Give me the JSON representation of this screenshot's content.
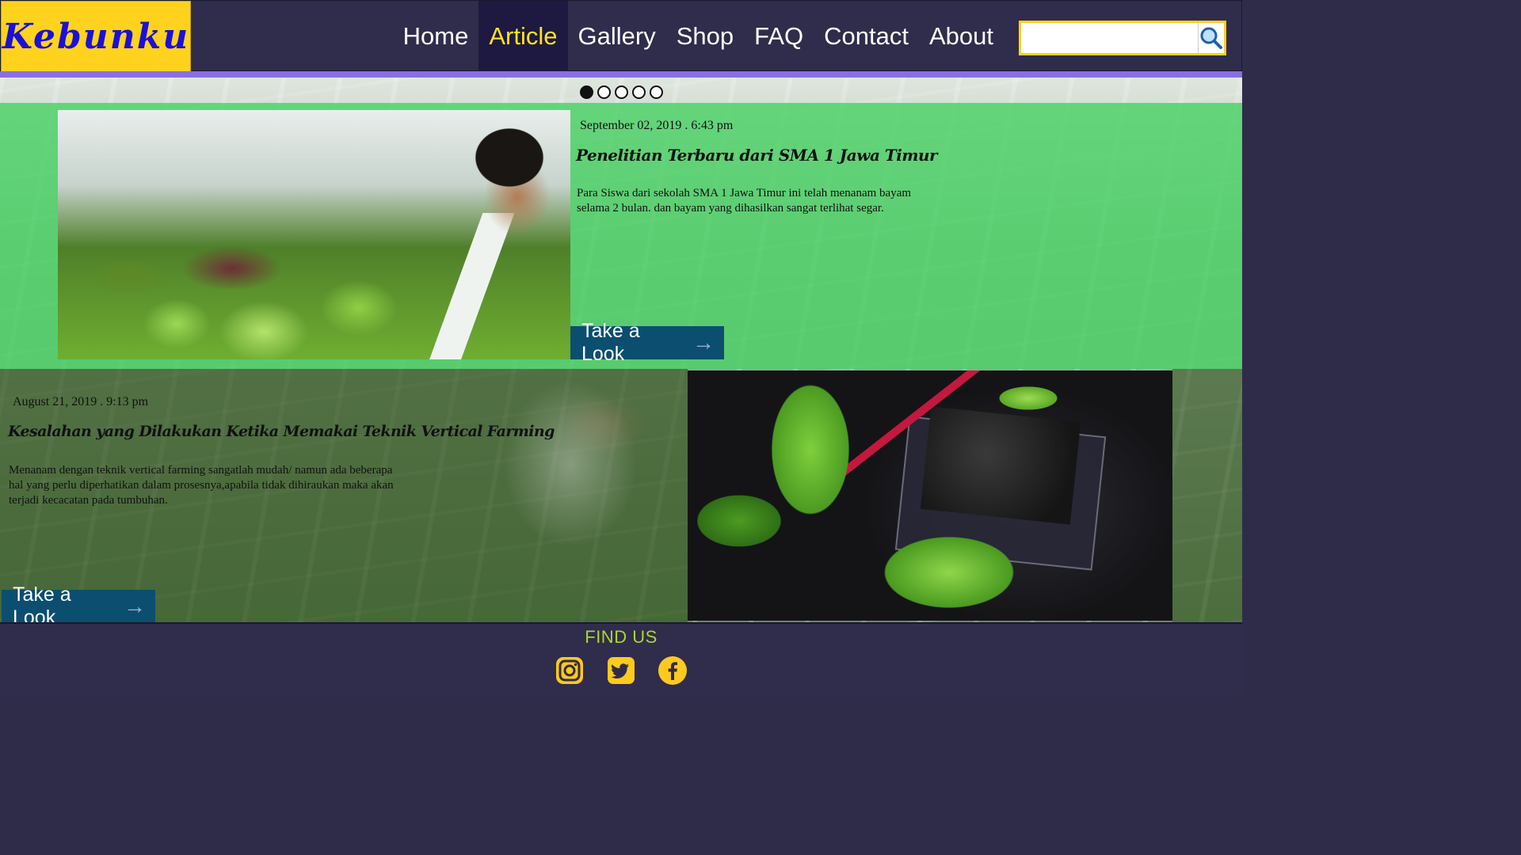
{
  "brand": {
    "logo_text": "Kebunku",
    "logo_color": "#1b10d8",
    "logo_bg": "#ffd21e"
  },
  "nav": {
    "items": [
      {
        "label": "Home",
        "active": false
      },
      {
        "label": "Article",
        "active": true
      },
      {
        "label": "Gallery",
        "active": false
      },
      {
        "label": "Shop",
        "active": false
      },
      {
        "label": "FAQ",
        "active": false
      },
      {
        "label": "Contact",
        "active": false
      },
      {
        "label": "About",
        "active": false
      }
    ],
    "active_color": "#ffe31f"
  },
  "search": {
    "value": "",
    "placeholder": "",
    "icon": "search-icon"
  },
  "carousel": {
    "dots": 5,
    "active_index": 0
  },
  "articles": [
    {
      "date": "September 02, 2019 . 6:43 pm",
      "title": "Penelitian Terbaru dari SMA 1 Jawa Timur",
      "body": "Para Siswa dari sekolah SMA 1 Jawa Timur ini telah menanam bayam selama 2 bulan. dan bayam yang dihasilkan sangat terlihat segar.",
      "button": "Take a Look"
    },
    {
      "date": "August 21, 2019 . 9:13 pm",
      "title": "Kesalahan yang Dilakukan Ketika Memakai Teknik Vertical Farming",
      "body": "Menanam dengan  teknik vertical farming sangatlah mudah/ namun ada beberapa hal yang perlu diperhatikan dalam prosesnya,apabila tidak dihiraukan maka akan terjadi kecacatan pada tumbuhan.",
      "button": "Take a Look"
    }
  ],
  "footer": {
    "heading": "FIND US",
    "heading_color": "#a9d82c",
    "social": [
      "instagram-icon",
      "twitter-icon",
      "facebook-icon"
    ],
    "icon_color": "#ffc91e"
  },
  "colors": {
    "header_bg": "#302c4c",
    "accent_line": "#8a6fe0",
    "article1_overlay": "#4ad266",
    "button_bg": "#0b4e70"
  }
}
